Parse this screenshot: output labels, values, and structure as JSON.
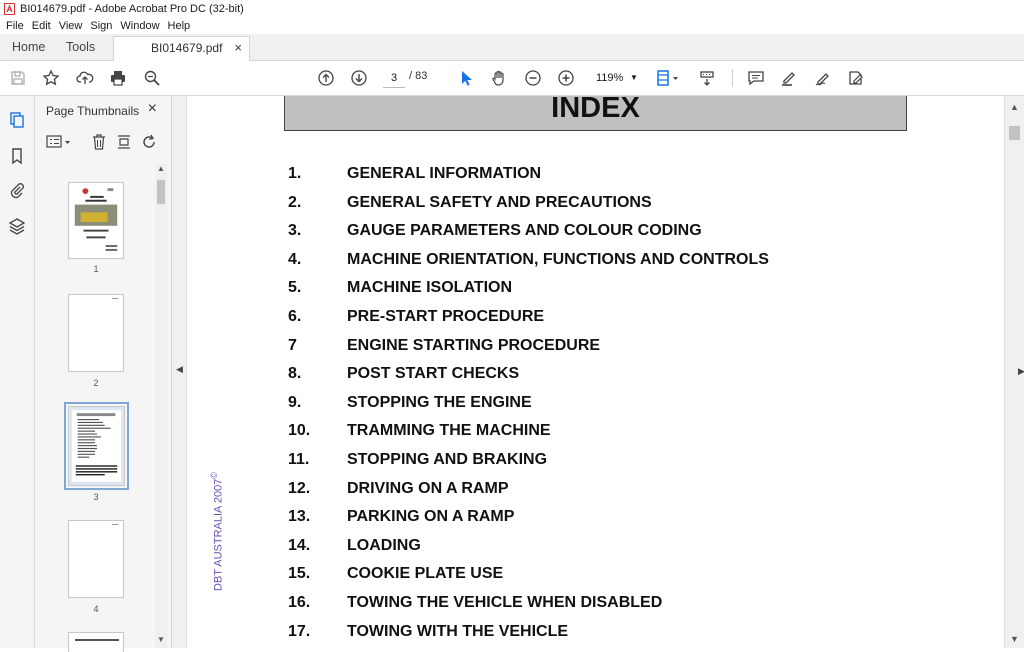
{
  "window": {
    "title": "BI014679.pdf - Adobe Acrobat Pro DC (32-bit)"
  },
  "menu": [
    "File",
    "Edit",
    "View",
    "Sign",
    "Window",
    "Help"
  ],
  "tabs": {
    "home": "Home",
    "tools": "Tools",
    "document": "BI014679.pdf",
    "close": "×"
  },
  "toolbar": {
    "current_page": "3",
    "total_pages": "/ 83",
    "zoom": "119%"
  },
  "thumbnails": {
    "title": "Page Thumbnails",
    "close": "×",
    "pages": [
      "1",
      "2",
      "3",
      "4"
    ],
    "selected_page": "3"
  },
  "document": {
    "heading": "INDEX",
    "entries": [
      {
        "num": "1.",
        "label": "GENERAL INFORMATION"
      },
      {
        "num": "2.",
        "label": "GENERAL SAFETY AND PRECAUTIONS"
      },
      {
        "num": "3.",
        "label": "GAUGE PARAMETERS AND COLOUR CODING"
      },
      {
        "num": "4.",
        "label": "MACHINE ORIENTATION, FUNCTIONS AND CONTROLS"
      },
      {
        "num": "5.",
        "label": "MACHINE ISOLATION"
      },
      {
        "num": "6.",
        "label": "PRE-START PROCEDURE"
      },
      {
        "num": "7",
        "label": "ENGINE STARTING PROCEDURE"
      },
      {
        "num": "8.",
        "label": "POST START CHECKS"
      },
      {
        "num": "9.",
        "label": "STOPPING THE ENGINE"
      },
      {
        "num": "10.",
        "label": "TRAMMING THE MACHINE"
      },
      {
        "num": "11.",
        "label": "STOPPING AND BRAKING"
      },
      {
        "num": "12.",
        "label": "DRIVING ON A RAMP"
      },
      {
        "num": "13.",
        "label": "PARKING ON A RAMP"
      },
      {
        "num": "14.",
        "label": "LOADING"
      },
      {
        "num": "15.",
        "label": "COOKIE PLATE USE"
      },
      {
        "num": "16.",
        "label": "TOWING THE VEHICLE WHEN DISABLED"
      },
      {
        "num": "17.",
        "label": "TOWING WITH THE VEHICLE"
      }
    ],
    "copyright": "DBT AUSTRALIA 2007",
    "copyright_mark": "©"
  },
  "colors": {
    "accent": "#1473e6",
    "selection": "#7fa7d6",
    "copyright": "#6a4fb0"
  }
}
